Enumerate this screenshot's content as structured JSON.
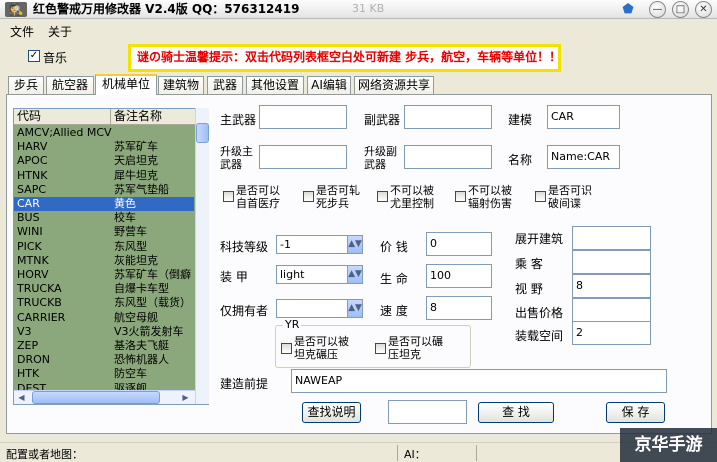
{
  "window": {
    "app_icon": "disguise-icon",
    "title": "红色警戒万用修改器 V2.4版  QQ：576312419",
    "size_text": "31 KB",
    "min_btn": "—",
    "max_btn": "□",
    "close_btn": "✕"
  },
  "menu": [
    "文件",
    "关于"
  ],
  "music": {
    "label": "音乐",
    "checked": "✓"
  },
  "hint": "谜の骑士温馨提示：双击代码列表框空白处可新建 步兵，航空，车辆等单位！！",
  "tabs": [
    "步兵",
    "航空器",
    "机械单位",
    "建筑物",
    "武器",
    "其他设置",
    "AI编辑",
    "网络资源共享"
  ],
  "list": {
    "headers": [
      "代码",
      "备注名称"
    ],
    "rows": [
      [
        "AMCV;Allied MCV",
        ""
      ],
      [
        "HARV",
        "苏军矿车"
      ],
      [
        "APOC",
        "天启坦克"
      ],
      [
        "HTNK",
        "犀牛坦克"
      ],
      [
        "SAPC",
        "苏军气垫船"
      ],
      [
        "CAR",
        "黄色"
      ],
      [
        "BUS",
        "校车"
      ],
      [
        "WINI",
        "野营车"
      ],
      [
        "PICK",
        "东风型"
      ],
      [
        "MTNK",
        "灰能坦克"
      ],
      [
        "HORV",
        "苏军矿车（倒癖"
      ],
      [
        "TRUCKA",
        "自爆卡车型"
      ],
      [
        "TRUCKB",
        "东风型（载货）"
      ],
      [
        "CARRIER",
        "航空母舰"
      ],
      [
        "V3",
        "V3火箭发射车"
      ],
      [
        "ZEP",
        "基洛夫飞艇"
      ],
      [
        "DRON",
        "恐怖机器人"
      ],
      [
        "HTK",
        "防空车"
      ],
      [
        "DEST",
        "驱逐舰"
      ]
    ]
  },
  "form": {
    "main_weapon": {
      "label": "主武器",
      "value": ""
    },
    "sub_weapon": {
      "label": "副武器",
      "value": ""
    },
    "model": {
      "label": "建模",
      "value": "CAR"
    },
    "upg_main": {
      "label1": "升级主",
      "label2": "武器",
      "value": ""
    },
    "upg_sub": {
      "label1": "升级副",
      "label2": "武器",
      "value": ""
    },
    "name": {
      "label": "名称",
      "value": "Name:CAR"
    },
    "checks": [
      {
        "l1": "是否可以",
        "l2": "自首医疗"
      },
      {
        "l1": "是否可轧",
        "l2": "死步兵"
      },
      {
        "l1": "不可以被",
        "l2": "尤里控制"
      },
      {
        "l1": "不可以被",
        "l2": "辐射伤害"
      },
      {
        "l1": "是否可识",
        "l2": "破间谍"
      }
    ],
    "tech": {
      "label": "科技等级",
      "value": "-1"
    },
    "armor": {
      "label": "装  甲",
      "value": "light"
    },
    "owner": {
      "label": "仅拥有者",
      "value": ""
    },
    "price": {
      "label": "价  钱",
      "value": "0"
    },
    "hp": {
      "label": "生  命",
      "value": "100"
    },
    "speed": {
      "label": "速  度",
      "value": "8"
    },
    "deploy": {
      "label": "展开建筑",
      "value": ""
    },
    "passengers": {
      "label": "乘  客",
      "value": ""
    },
    "sight": {
      "label": "视  野",
      "value": "8"
    },
    "sell": {
      "label": "出售价格",
      "value": ""
    },
    "space": {
      "label": "装载空间",
      "value": "2"
    },
    "yr": {
      "label": "YR",
      "c1": {
        "l1": "是否可以被",
        "l2": "坦克碾压"
      },
      "c2": {
        "l1": "是否可以碾",
        "l2": "压坦克"
      }
    },
    "prereq": {
      "label": "建造前提",
      "value": "NAWEAP"
    },
    "search_help": "查找说明",
    "search_input": "",
    "search_btn": "查  找",
    "save_btn": "保  存"
  },
  "status": {
    "left": "配置或者地图：",
    "right": "AI："
  },
  "watermark": "京华手游"
}
